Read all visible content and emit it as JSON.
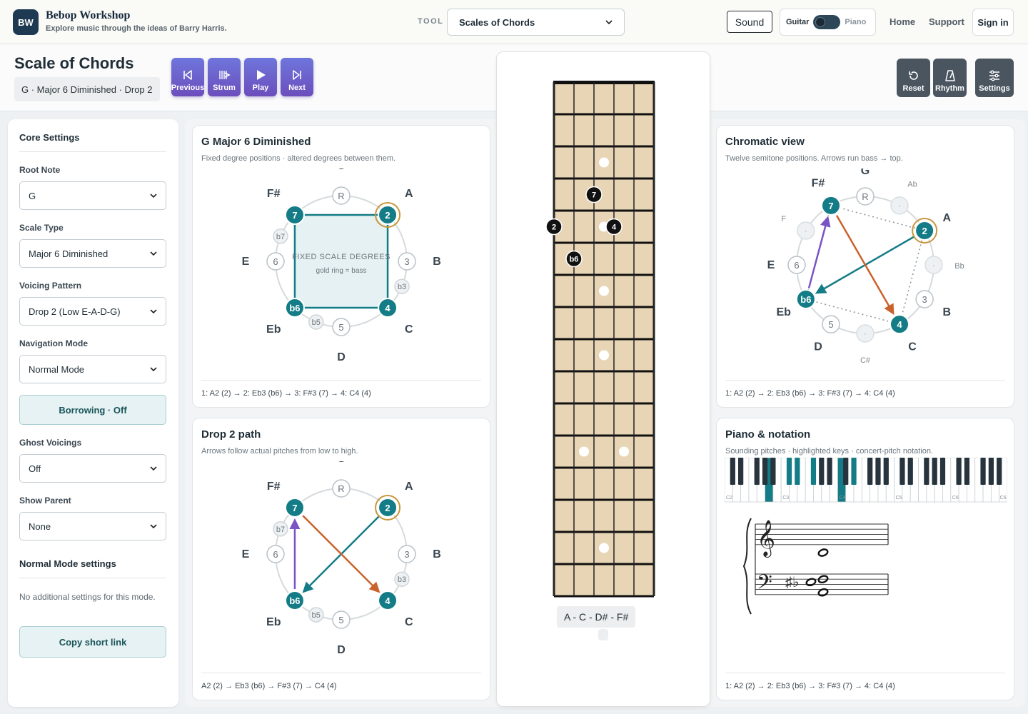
{
  "nav": {
    "logo": "BW",
    "brand_title": "Bebop Workshop",
    "brand_subtitle": "Explore music through the ideas of Barry Harris.",
    "tool_label": "TOOL",
    "tool_value": "Scales of Chords",
    "sound": "Sound",
    "guitar": "Guitar",
    "piano": "Piano",
    "home": "Home",
    "support": "Support",
    "sign_in": "Sign in"
  },
  "header": {
    "title": "Scale of Chords",
    "chord": "G · Major 6 Diminished · Drop 2",
    "transport": [
      "Previous",
      "Strum",
      "Play",
      "Next"
    ],
    "tools": [
      "Reset",
      "Rhythm",
      "Settings"
    ]
  },
  "sidebar": {
    "heading": "Core Settings",
    "root_label": "Root Note",
    "root_value": "G",
    "scale_label": "Scale Type",
    "scale_value": "Major 6 Diminished",
    "voicing_label": "Voicing Pattern",
    "voicing_value": "Drop 2 (Low E-A-D-G)",
    "nav_label": "Navigation Mode",
    "nav_value": "Normal Mode",
    "borrowing": "Borrowing · Off",
    "ghost_label": "Ghost Voicings",
    "ghost_value": "Off",
    "parent_label": "Show Parent",
    "parent_value": "None",
    "mode_heading": "Normal Mode settings",
    "mode_note": "No additional settings for this mode.",
    "copy_link": "Copy short link"
  },
  "degree_card": {
    "title": "G Major 6 Diminished",
    "subtitle": "Fixed degree positions · altered degrees between them.",
    "center_1": "FIXED SCALE DEGREES",
    "center_2": "gold ring = bass",
    "footer": "1: A2 (2) → 2: Eb3 (b6) → 3: F#3 (7) → 4: C4 (4)"
  },
  "drop_card": {
    "title": "Drop 2 path",
    "subtitle": "Arrows follow actual pitches from low to high.",
    "footer": "A2 (2) → Eb3 (b6) → F#3 (7) → C4 (4)"
  },
  "wheel": {
    "outer": [
      "G",
      "A",
      "B",
      "C",
      "D",
      "Eb",
      "E",
      "F#"
    ],
    "nodes": [
      "R",
      "2",
      "3",
      "4",
      "5",
      "b6",
      "6",
      "7"
    ],
    "altered": [
      "b3",
      "b5",
      "b7"
    ]
  },
  "chromatic_card": {
    "title": "Chromatic view",
    "subtitle": "Twelve semitone positions. Arrows run bass → top.",
    "outer": [
      "G",
      "Ab",
      "A",
      "Bb",
      "B",
      "C",
      "C#",
      "D",
      "Eb",
      "E",
      "F",
      "F#"
    ],
    "nodes": [
      "R",
      "·",
      "2",
      "·",
      "3",
      "4",
      "·",
      "5",
      "b6",
      "6",
      "·",
      "7"
    ],
    "footer": "1: A2 (2) → 2: Eb3 (b6) → 3: F#3 (7) → 4: C4 (4)"
  },
  "piano_card": {
    "title": "Piano & notation",
    "subtitle": "Sounding pitches · highlighted keys · concert-pitch notation.",
    "octaves": [
      "C2",
      "C3",
      "C4",
      "C5",
      "C6"
    ],
    "accidental": "♯♭",
    "footer": "1: A2 (2) → 2: Eb3 (b6) → 3: F#3 (7) → 4: C4 (4)"
  },
  "fretboard": {
    "notes": "A - C - D# - F#",
    "fingers": [
      "2",
      "b6",
      "7",
      "4"
    ]
  }
}
